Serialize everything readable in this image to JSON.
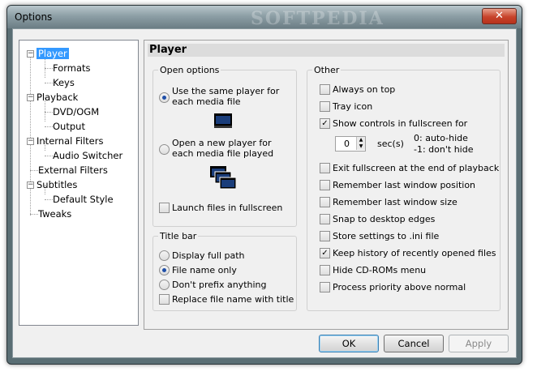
{
  "window": {
    "title": "Options",
    "watermark": "SOFTPEDIA",
    "close_glyph": "✕"
  },
  "tree": {
    "items": [
      {
        "label": "Player",
        "selected": true
      },
      {
        "label": "Formats"
      },
      {
        "label": "Keys"
      },
      {
        "label": "Playback"
      },
      {
        "label": "DVD/OGM"
      },
      {
        "label": "Output"
      },
      {
        "label": "Internal Filters"
      },
      {
        "label": "Audio Switcher"
      },
      {
        "label": "External Filters"
      },
      {
        "label": "Subtitles"
      },
      {
        "label": "Default Style"
      },
      {
        "label": "Tweaks"
      }
    ],
    "expander_glyph": "−"
  },
  "page": {
    "header": "Player",
    "open_options": {
      "title": "Open options",
      "same_player": "Use the same player for\neach media file",
      "same_player_selected": true,
      "new_player": "Open a new player for\neach media file played",
      "new_player_selected": false,
      "launch_fullscreen": "Launch files in fullscreen",
      "launch_fullscreen_checked": false
    },
    "title_bar": {
      "title": "Title bar",
      "display_full_path": "Display full path",
      "file_name_only": "File name only",
      "dont_prefix": "Don't prefix anything",
      "selected": "file_name_only",
      "replace_file_name": "Replace file name with title",
      "replace_file_name_checked": false
    },
    "other": {
      "title": "Other",
      "always_on_top": {
        "label": "Always on top",
        "checked": false
      },
      "tray_icon": {
        "label": "Tray icon",
        "checked": false
      },
      "show_controls": {
        "label": "Show controls in fullscreen for",
        "checked": true
      },
      "seconds_value": "0",
      "seconds_unit": "sec(s)",
      "hint_auto_hide": "0: auto-hide",
      "hint_dont_hide": "-1: don't hide",
      "exit_fullscreen": {
        "label": "Exit fullscreen at the end of playback",
        "checked": false
      },
      "remember_position": {
        "label": "Remember last window position",
        "checked": false
      },
      "remember_size": {
        "label": "Remember last window size",
        "checked": false
      },
      "snap_edges": {
        "label": "Snap to desktop edges",
        "checked": false
      },
      "store_ini": {
        "label": "Store settings to .ini file",
        "checked": false
      },
      "keep_history": {
        "label": "Keep history of recently opened files",
        "checked": true
      },
      "hide_cdrom": {
        "label": "Hide CD-ROMs menu",
        "checked": false
      },
      "process_priority": {
        "label": "Process priority above normal",
        "checked": false
      }
    },
    "check_glyph": "✓"
  },
  "buttons": {
    "ok": "OK",
    "cancel": "Cancel",
    "apply": "Apply"
  }
}
